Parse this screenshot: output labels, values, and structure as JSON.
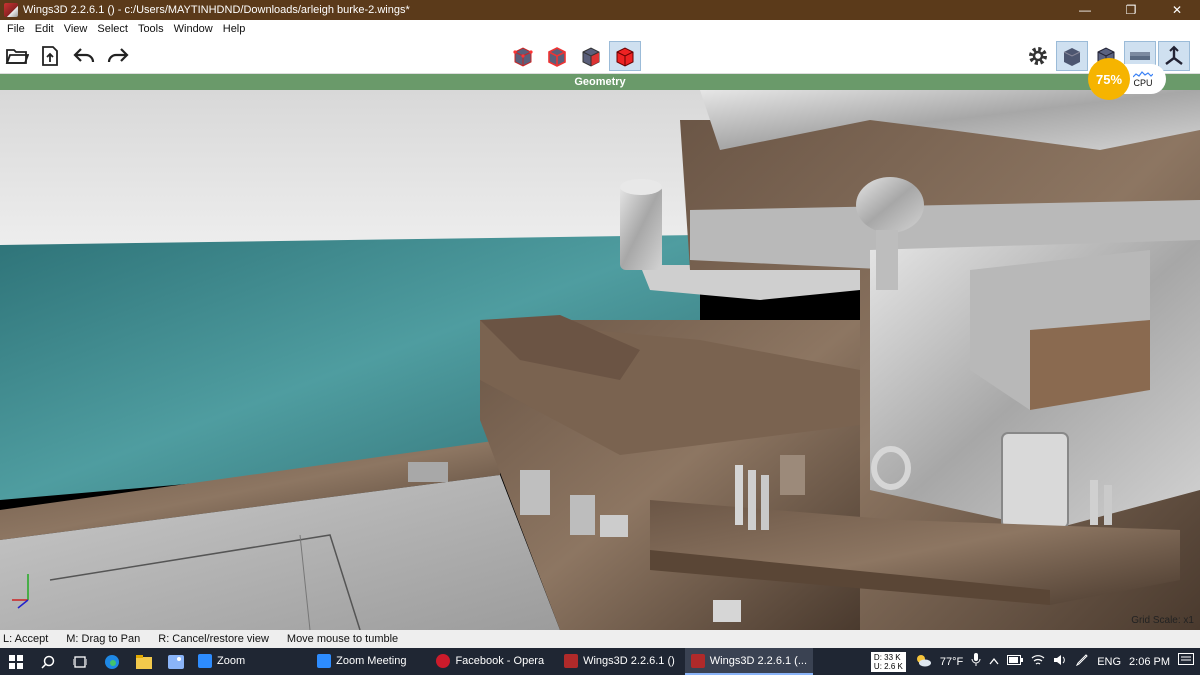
{
  "window": {
    "title": "Wings3D 2.2.6.1 () - c:/Users/MAYTINHDND/Downloads/arleigh burke-2.wings*",
    "minimize": "—",
    "maximize": "❐",
    "close": "✕"
  },
  "menu": [
    "File",
    "Edit",
    "View",
    "Select",
    "Tools",
    "Window",
    "Help"
  ],
  "toolbar": {
    "left_icons": [
      "open-folder-icon",
      "save-icon",
      "undo-icon",
      "redo-icon"
    ],
    "selection_modes": [
      {
        "name": "vertex-select",
        "active": false
      },
      {
        "name": "edge-select",
        "active": false
      },
      {
        "name": "face-select",
        "active": false
      },
      {
        "name": "body-select",
        "active": true
      }
    ],
    "right_icons": [
      "settings-icon",
      "smooth-preview-icon",
      "wireframe-icon",
      "ground-plane-icon",
      "axes-icon"
    ]
  },
  "viewport": {
    "header": "Geometry",
    "grid_scale": "Grid Scale: x1"
  },
  "cpu": {
    "percent": "75%",
    "label": "CPU"
  },
  "status": {
    "items": [
      "L: Accept",
      "M: Drag to Pan",
      "R: Cancel/restore view",
      "Move mouse to tumble"
    ]
  },
  "taskbar": {
    "apps": [
      {
        "label": "Zoom",
        "color": "#2d8cff",
        "active": false
      },
      {
        "label": "Zoom Meeting",
        "color": "#2d8cff",
        "active": false
      },
      {
        "label": "Facebook - Opera",
        "color": "#cc1b2b",
        "active": false
      },
      {
        "label": "Wings3D 2.2.6.1 ()",
        "color": "#b02a2a",
        "active": false
      },
      {
        "label": "Wings3D 2.2.6.1 (...",
        "color": "#b02a2a",
        "active": true
      }
    ],
    "net_down": "D: 33 K",
    "net_up": "U: 2.6 K",
    "temperature": "77°F",
    "language": "ENG",
    "time": "2:06 PM"
  },
  "colors": {
    "titlebar": "#5b3a1a",
    "geometry_header": "#6a9a6a",
    "cpu_badge": "#f6b400",
    "sea": "#3f8a8e",
    "sky": "#dcdcdc"
  }
}
